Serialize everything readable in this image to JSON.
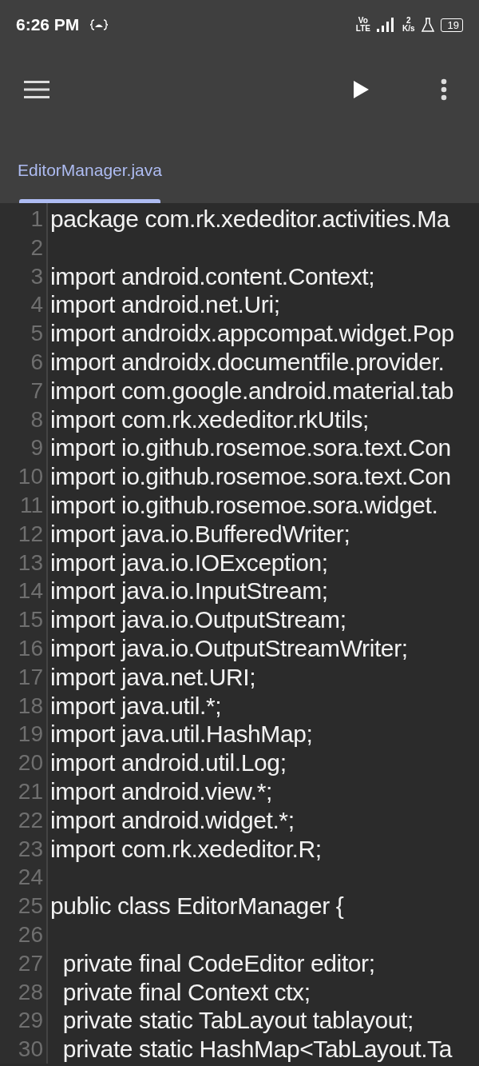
{
  "status_bar": {
    "time": "6:26 PM",
    "network": {
      "top": "Vo",
      "bottom": "LTE"
    },
    "speed": {
      "value": "2",
      "unit": "K/s"
    },
    "battery": "19"
  },
  "toolbar": {
    "actions": [
      {
        "kind": "menu"
      },
      {
        "kind": "run"
      },
      {
        "kind": "more"
      }
    ]
  },
  "tabs": [
    {
      "label": "EditorManager.java",
      "selected": true
    }
  ],
  "editor": {
    "lines": [
      {
        "number": "1",
        "text": "package com.rk.xededitor.activities.Ma"
      },
      {
        "number": "2"
      },
      {
        "number": "3",
        "text": "import android.content.Context;"
      },
      {
        "number": "4",
        "text": "import android.net.Uri;"
      },
      {
        "number": "5",
        "text": "import androidx.appcompat.widget.Pop"
      },
      {
        "number": "6",
        "text": "import androidx.documentfile.provider."
      },
      {
        "number": "7",
        "text": "import com.google.android.material.tab"
      },
      {
        "number": "8",
        "text": "import com.rk.xededitor.rkUtils;"
      },
      {
        "number": "9",
        "text": "import io.github.rosemoe.sora.text.Con"
      },
      {
        "number": "10",
        "text": "import io.github.rosemoe.sora.text.Con"
      },
      {
        "number": "11",
        "text": "import io.github.rosemoe.sora.widget."
      },
      {
        "number": "12",
        "text": "import java.io.BufferedWriter;"
      },
      {
        "number": "13",
        "text": "import java.io.IOException;"
      },
      {
        "number": "14",
        "text": "import java.io.InputStream;"
      },
      {
        "number": "15",
        "text": "import java.io.OutputStream;"
      },
      {
        "number": "16",
        "text": "import java.io.OutputStreamWriter;"
      },
      {
        "number": "17",
        "text": "import java.net.URI;"
      },
      {
        "number": "18",
        "text": "import java.util.*;"
      },
      {
        "number": "19",
        "text": "import java.util.HashMap;"
      },
      {
        "number": "20",
        "text": "import android.util.Log;"
      },
      {
        "number": "21",
        "text": "import android.view.*;"
      },
      {
        "number": "22",
        "text": "import android.widget.*;"
      },
      {
        "number": "23",
        "text": "import com.rk.xededitor.R;"
      },
      {
        "number": "24"
      },
      {
        "number": "25",
        "text": "public class EditorManager {"
      },
      {
        "number": "26"
      },
      {
        "number": "27",
        "text": "  private final CodeEditor editor;"
      },
      {
        "number": "28",
        "text": "  private final Context ctx;"
      },
      {
        "number": "29",
        "text": "  private static TabLayout tablayout;"
      },
      {
        "number": "30",
        "text": "  private static HashMap<TabLayout.Ta"
      }
    ]
  }
}
